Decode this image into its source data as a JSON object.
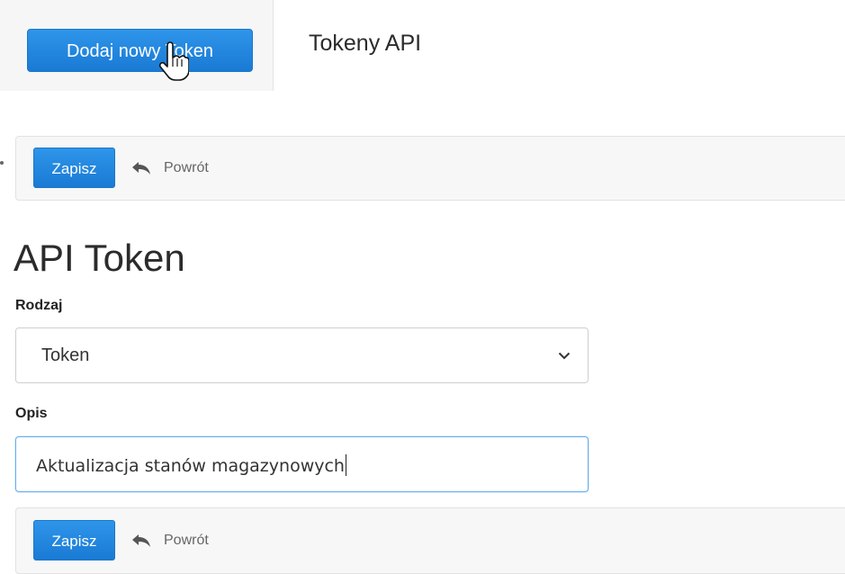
{
  "header": {
    "add_button_label": "Dodaj nowy Token",
    "title": "Tokeny API"
  },
  "toolbar_top": {
    "save_label": "Zapisz",
    "back_label": "Powrót"
  },
  "form": {
    "title": "API Token",
    "type_label": "Rodzaj",
    "type_value": "Token",
    "description_label": "Opis",
    "description_value": "Aktualizacja stanów magazynowych"
  },
  "toolbar_bottom": {
    "save_label": "Zapisz",
    "back_label": "Powrót"
  },
  "colors": {
    "primary": "#1f87e0",
    "toolbar_bg": "#f7f7f7"
  },
  "icons": {
    "cursor": "hand-pointer-icon",
    "back": "reply-arrow-icon",
    "select": "chevron-down-icon"
  }
}
